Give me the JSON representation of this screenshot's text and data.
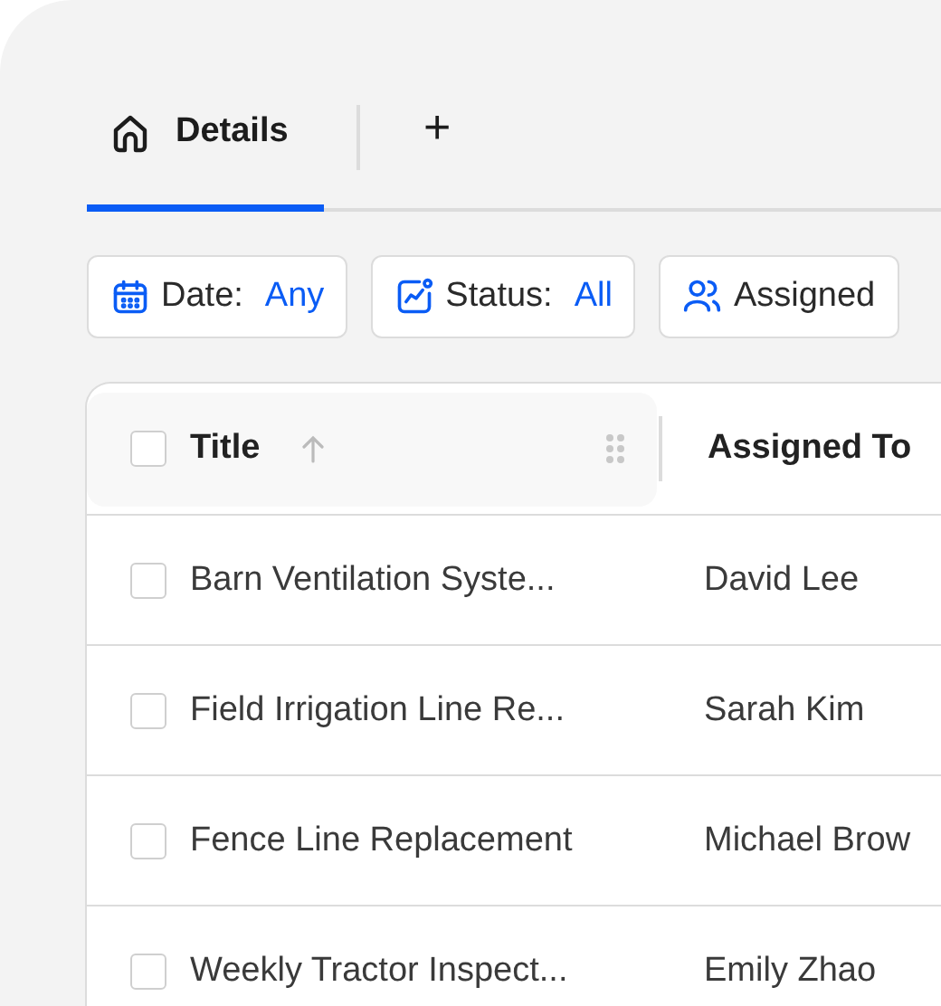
{
  "tabs": [
    {
      "label": "Details",
      "selected": true
    }
  ],
  "add_tab": "+",
  "filters": [
    {
      "kind": "date",
      "label": "Date:",
      "value": "Any"
    },
    {
      "kind": "status",
      "label": "Status:",
      "value": "All"
    },
    {
      "kind": "assignee",
      "label": "Assigned"
    }
  ],
  "table": {
    "select_all": {
      "checked": false
    },
    "columns": [
      "Title",
      "Assigned To"
    ],
    "rows": [
      {
        "checked": false,
        "cells": [
          "Barn Ventilation Syste...",
          "David Lee"
        ]
      },
      {
        "checked": false,
        "cells": [
          "Field Irrigation Line Re...",
          "Sarah Kim"
        ]
      },
      {
        "checked": false,
        "cells": [
          "Fence Line Replacement",
          "Michael Brow"
        ]
      },
      {
        "checked": false,
        "cells": [
          "Weekly Tractor Inspect...",
          "Emily Zhao"
        ]
      }
    ]
  }
}
